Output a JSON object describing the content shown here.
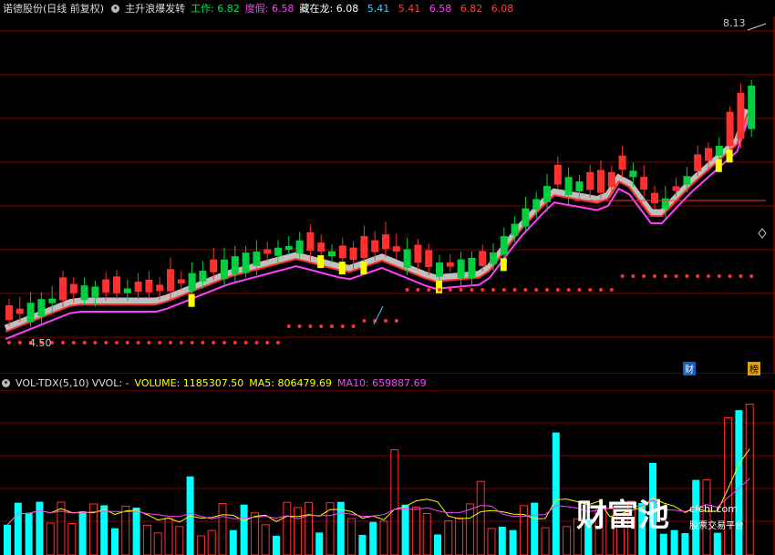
{
  "header": {
    "stock_name": "诺德股份(日线 前复权)",
    "indicator_name": "主升浪爆发转",
    "items": [
      {
        "label": "工作:",
        "value": "6.82",
        "color": "#00e060"
      },
      {
        "label": "度假:",
        "value": "6.58",
        "color": "#ff40ff"
      },
      {
        "label": "藏在龙:",
        "value": "6.08",
        "color": "#ffffff"
      },
      {
        "label": "",
        "value": "5.41",
        "color": "#40d0ff"
      },
      {
        "label": "",
        "value": "5.41",
        "color": "#ff4040"
      },
      {
        "label": "",
        "value": "6.58",
        "color": "#ff40ff"
      },
      {
        "label": "",
        "value": "6.82",
        "color": "#ff4040"
      },
      {
        "label": "",
        "value": "6.08",
        "color": "#ff4040"
      }
    ]
  },
  "price_labels": {
    "high": "8.13",
    "low": "4.50"
  },
  "markers": {
    "fin": "财",
    "bang": "榜"
  },
  "volume_header": {
    "name": "VOL-TDX(5,10)",
    "vvol": "VVOL: -",
    "volume": "VOLUME: 1185307.50",
    "ma5": "MA5: 806479.69",
    "ma10": "MA10: 659887.69"
  },
  "watermark": {
    "logo": "财富池",
    "url": "cfchi.com",
    "tagline": "股票交易平台"
  },
  "colors": {
    "up": "#ff3030",
    "down": "#00ffff",
    "green_bar": "#00d040",
    "yellow": "#ffff00",
    "magenta": "#ff40ff",
    "grid": "#800000"
  }
}
